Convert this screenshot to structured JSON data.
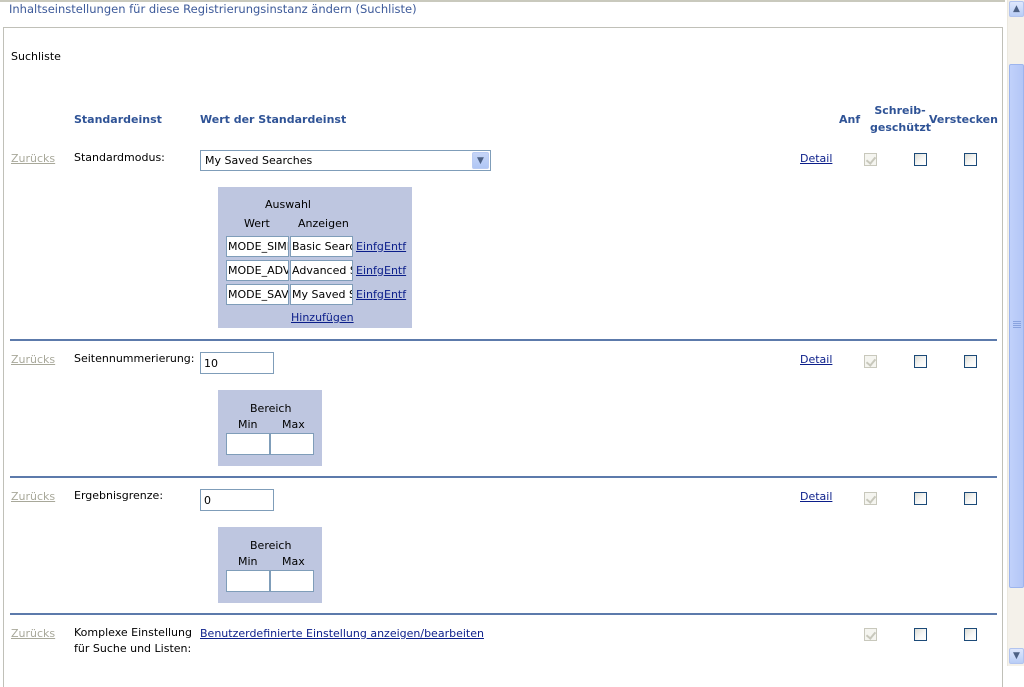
{
  "page_title": "Inhaltseinstellungen für diese Registrierungsinstanz ändern (Suchliste)",
  "section_title": "Suchliste",
  "columns": {
    "default_setting": "Standardeinst",
    "default_value": "Wert der Standardeinst",
    "required": "Anf",
    "readonly_line1": "Schreib-",
    "readonly_line2": "geschützt",
    "hide": "Verstecken"
  },
  "rows": [
    {
      "reset_label": "Zurücks",
      "label": "Standardmodus:",
      "selected": "My Saved Searches",
      "detail_label": "Detail",
      "required_checked": true,
      "readonly_checked": false,
      "hide_checked": false,
      "choices_box": {
        "title": "Auswahl",
        "col_value": "Wert",
        "col_display": "Anzeigen",
        "items": [
          {
            "value": "MODE_SIMPLE",
            "display": "Basic Search"
          },
          {
            "value": "MODE_ADVANCED",
            "display": "Advanced Search"
          },
          {
            "value": "MODE_SAVED",
            "display": "My Saved Searches"
          }
        ],
        "insert_label": "Einfg",
        "delete_label": "Entf",
        "add_label": "Hinzufügen"
      }
    },
    {
      "reset_label": "Zurücks",
      "label": "Seitennummerierung:",
      "value": "10",
      "detail_label": "Detail",
      "required_checked": true,
      "readonly_checked": false,
      "hide_checked": false,
      "range": {
        "title": "Bereich",
        "min_label": "Min",
        "max_label": "Max",
        "min": "",
        "max": ""
      }
    },
    {
      "reset_label": "Zurücks",
      "label": "Ergebnisgrenze:",
      "value": "0",
      "detail_label": "Detail",
      "required_checked": true,
      "readonly_checked": false,
      "hide_checked": false,
      "range": {
        "title": "Bereich",
        "min_label": "Min",
        "max_label": "Max",
        "min": "",
        "max": ""
      }
    },
    {
      "reset_label": "Zurücks",
      "label_line1": "Komplexe Einstellung",
      "label_line2": "für Suche und Listen:",
      "link_label": "Benutzerdefinierte Einstellung anzeigen/bearbeiten",
      "required_checked": true,
      "readonly_checked": false,
      "hide_checked": false
    }
  ],
  "scrollbar": {
    "up_icon": "▲",
    "down_icon": "▼"
  }
}
